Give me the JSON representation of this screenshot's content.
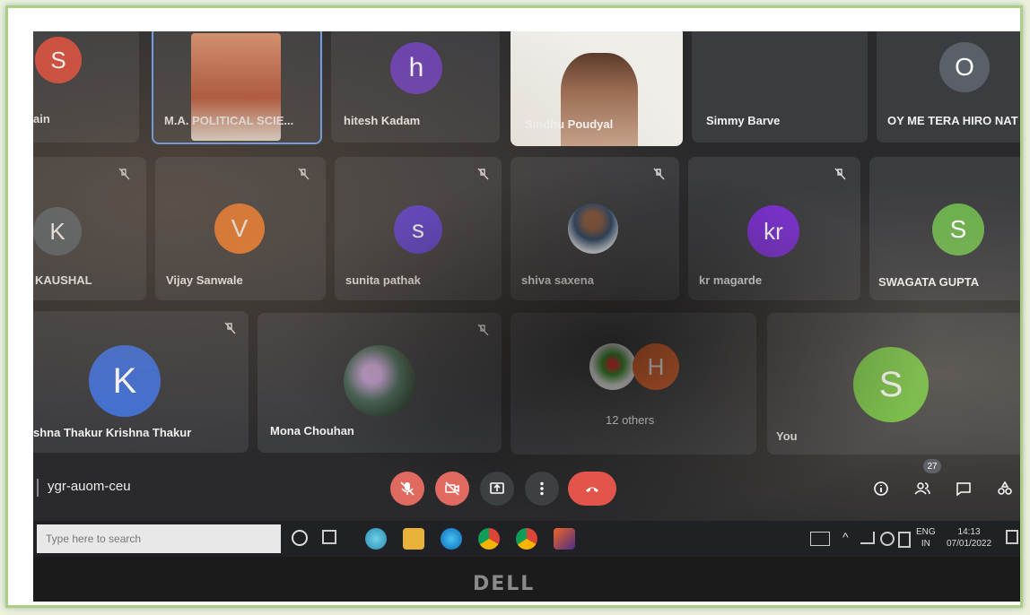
{
  "participants": {
    "row1": [
      {
        "name": "ain",
        "initial": "S",
        "color": "#d44c3e"
      },
      {
        "name": "M.A. POLITICAL SCIE...",
        "photo": true
      },
      {
        "name": "hitesh Kadam",
        "initial": "h",
        "color": "#6a3fb5"
      },
      {
        "name": "Sindhu Poudyal",
        "photo": true
      },
      {
        "name": "Simmy Barve"
      },
      {
        "name": "OY ME TERA HIRO NAT",
        "initial": "O",
        "color": "#5a6068"
      }
    ],
    "row2": [
      {
        "name": "KAUSHAL",
        "initial": "K",
        "color": "#53606a"
      },
      {
        "name": "Vijay Sanwale",
        "initial": "V",
        "color": "#f07a2b"
      },
      {
        "name": "sunita pathak",
        "initial": "s",
        "color": "#5a3fd0"
      },
      {
        "name": "shiva saxena",
        "photo": true
      },
      {
        "name": "kr magarde",
        "initial": "kr",
        "color": "#7a2fd0"
      },
      {
        "name": "SWAGATA GUPTA",
        "initial": "S",
        "color": "#6ab04c"
      }
    ],
    "row3": [
      {
        "name": "shna Thakur Krishna Thakur",
        "initial": "K",
        "color": "#3f6fd6"
      },
      {
        "name": "Mona Chouhan",
        "photo": true
      },
      {
        "name": "12 others",
        "initial": "H",
        "color": "#e4622a"
      },
      {
        "name": "You",
        "initial": "S",
        "color": "#6abf3c"
      }
    ]
  },
  "meeting": {
    "code": "ygr-auom-ceu",
    "people_count": "27"
  },
  "taskbar": {
    "search_placeholder": "Type here to search",
    "lang": "ENG",
    "region": "IN",
    "time": "14:13",
    "date": "07/01/2022"
  },
  "bezel": {
    "brand": "DELL"
  },
  "colors": {
    "end_call": "#e3554b",
    "muted_button": "#e06a5f",
    "tile_bg": "#3b3c40"
  }
}
